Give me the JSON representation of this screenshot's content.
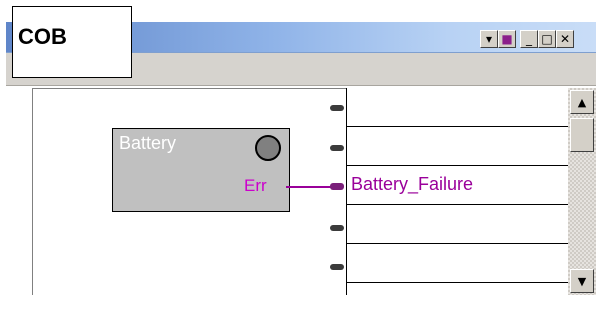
{
  "label": "COB",
  "window": {
    "controls": [
      {
        "name": "dropdown-icon",
        "glyph": "▾"
      },
      {
        "name": "color-swatch-icon",
        "glyph": "■"
      },
      {
        "name": "minimize-icon",
        "glyph": "_"
      },
      {
        "name": "maximize-icon",
        "glyph": "□"
      },
      {
        "name": "close-icon",
        "glyph": "✕"
      }
    ],
    "accent": "#990099",
    "titlebar_color": "#8fb3e8"
  },
  "block": {
    "title": "Battery",
    "output_port": "Err"
  },
  "io_rows": [
    "",
    "",
    "Battery_Failure",
    "",
    "",
    ""
  ],
  "scrollbar": {
    "up_glyph": "▲",
    "down_glyph": "▼"
  }
}
